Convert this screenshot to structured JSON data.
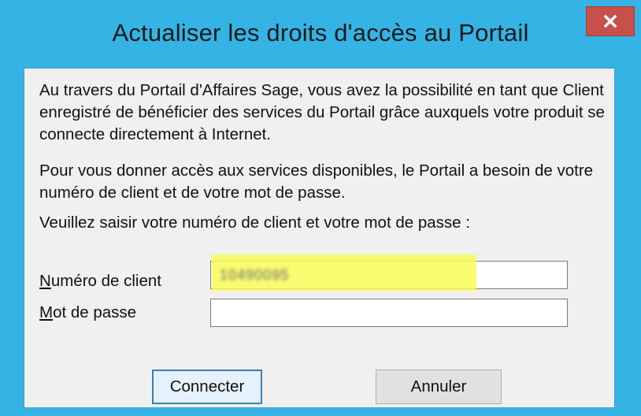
{
  "dialog": {
    "title": "Actualiser les droits d'accès au Portail",
    "close_label": "x"
  },
  "body": {
    "paragraph_1": "Au travers du Portail d'Affaires Sage, vous avez la possibilité en tant que Client enregistré de bénéficier des services du Portail grâce auxquels votre produit se connecte directement à Internet.",
    "paragraph_2": "Pour vous donner accès aux services disponibles, le Portail a besoin de votre numéro de client et de votre mot de passe.",
    "paragraph_3": "Veuillez saisir votre numéro de client et votre mot de passe :"
  },
  "form": {
    "client_label_mnemonic": "N",
    "client_label_rest": "uméro de client",
    "client_value": "10490095",
    "password_label_mnemonic": "M",
    "password_label_rest": "ot de passe",
    "password_value": ""
  },
  "buttons": {
    "connect": "Connecter",
    "cancel": "Annuler"
  },
  "colors": {
    "title_bar": "#35b3e5",
    "close_button": "#c7504a",
    "highlight": "#f8fa50",
    "client_area": "#f0f0f0"
  },
  "icons": {
    "close": "close-icon"
  }
}
